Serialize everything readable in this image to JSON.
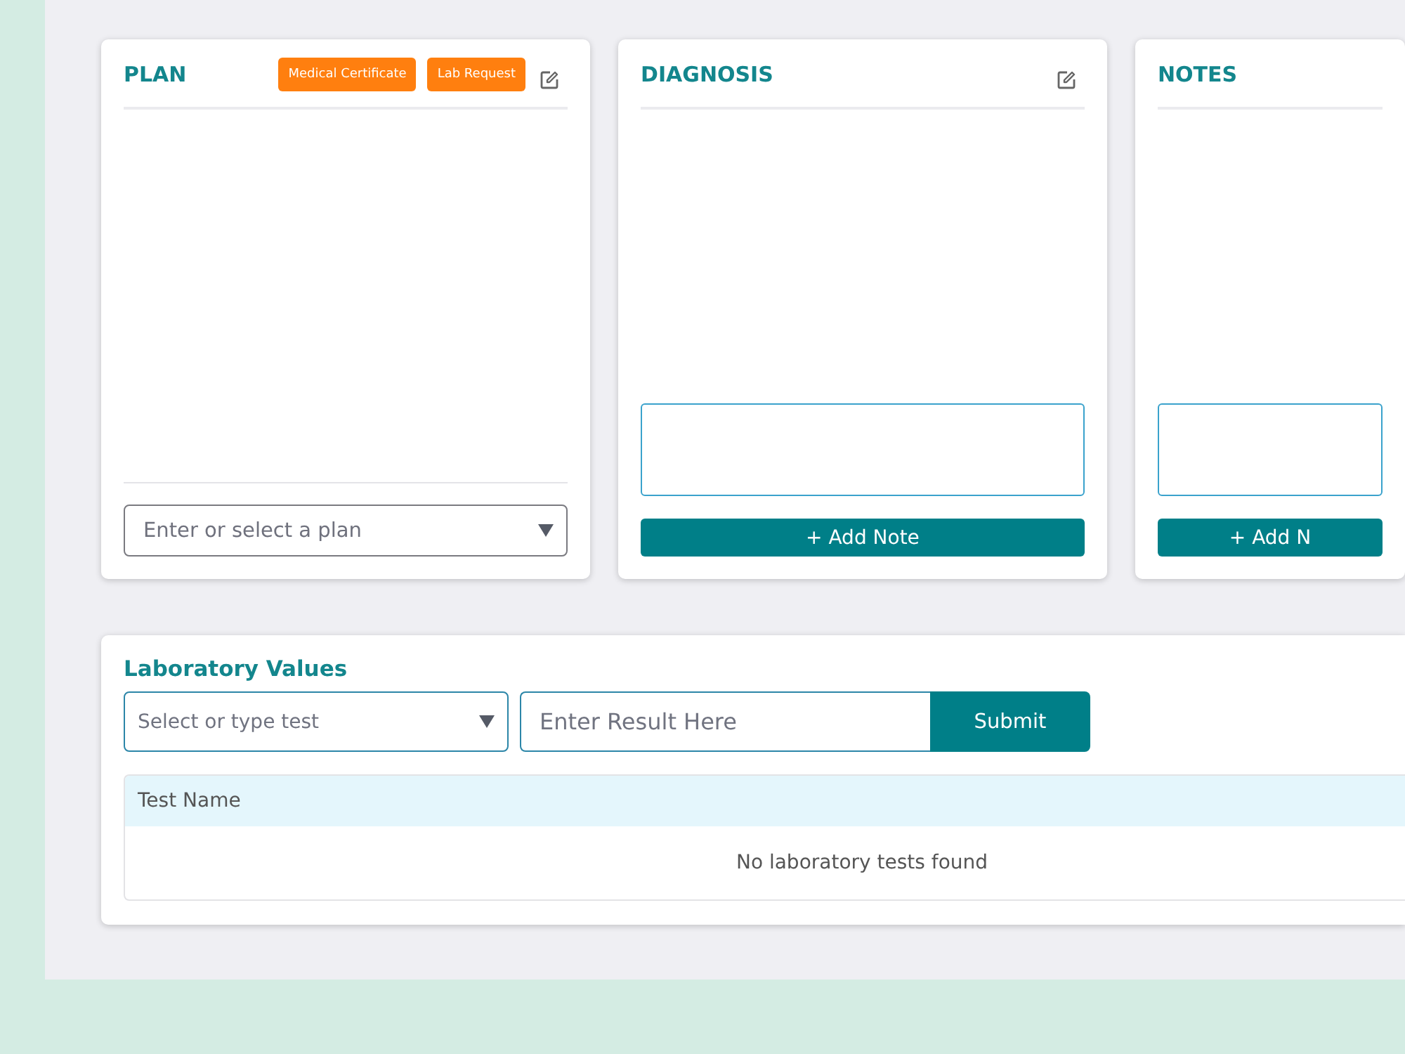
{
  "cards": [
    {
      "title": "PLAN",
      "badges": [
        "Medical Certificate",
        "Lab Request"
      ],
      "edit_icon": true,
      "input": {
        "kind": "select",
        "placeholder": "Enter or select a plan"
      }
    },
    {
      "title": "DIAGNOSIS",
      "edit_icon": true,
      "input": {
        "kind": "textarea"
      },
      "button": "+ Add Note"
    },
    {
      "title": "NOTES",
      "edit_icon": false,
      "input": {
        "kind": "textarea"
      },
      "button": "+ Add N"
    }
  ],
  "laboratory": {
    "title": "Laboratory Values",
    "test_select": {
      "placeholder": "Select or type test"
    },
    "result_input": {
      "placeholder": "Enter Result Here"
    },
    "submit": "Submit",
    "table": {
      "columns": [
        "Test Name"
      ],
      "empty_message": "No laboratory tests found"
    }
  }
}
